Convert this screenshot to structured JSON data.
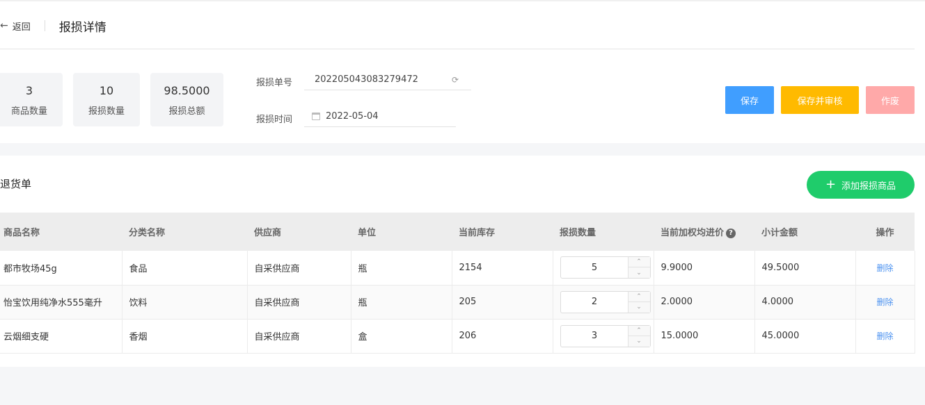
{
  "header": {
    "back_label": "返回",
    "title": "报损详情"
  },
  "stats": [
    {
      "value": "3",
      "label": "商品数量"
    },
    {
      "value": "10",
      "label": "报损数量"
    },
    {
      "value": "98.5000",
      "label": "报损总额"
    }
  ],
  "form": {
    "order_no_label": "报损单号",
    "order_no_value": "202205043083279472",
    "time_label": "报损时间",
    "time_value": "2022-05-04"
  },
  "actions": {
    "save": "保存",
    "save_review": "保存并审核",
    "void": "作废"
  },
  "colors": {
    "save": "#409eff",
    "save_review": "#ffba00",
    "void": "#ffa9a9",
    "add": "#1fcc6b",
    "link": "#4c92f0"
  },
  "section": {
    "title": "退货单",
    "add_button": "添加报损商品"
  },
  "table": {
    "headers": [
      "商品名称",
      "分类名称",
      "供应商",
      "单位",
      "当前库存",
      "报损数量",
      "当前加权均进价",
      "小计金额",
      "操作"
    ],
    "rows": [
      {
        "name": "都市牧场45g",
        "category": "食品",
        "supplier": "自采供应商",
        "unit": "瓶",
        "stock": "2154",
        "qty": "5",
        "price": "9.9000",
        "subtotal": "49.5000",
        "op": "删除"
      },
      {
        "name": "怡宝饮用纯净水555毫升",
        "category": "饮料",
        "supplier": "自采供应商",
        "unit": "瓶",
        "stock": "205",
        "qty": "2",
        "price": "2.0000",
        "subtotal": "4.0000",
        "op": "删除"
      },
      {
        "name": "云烟细支硬",
        "category": "香烟",
        "supplier": "自采供应商",
        "unit": "盒",
        "stock": "206",
        "qty": "3",
        "price": "15.0000",
        "subtotal": "45.0000",
        "op": "删除"
      }
    ]
  }
}
